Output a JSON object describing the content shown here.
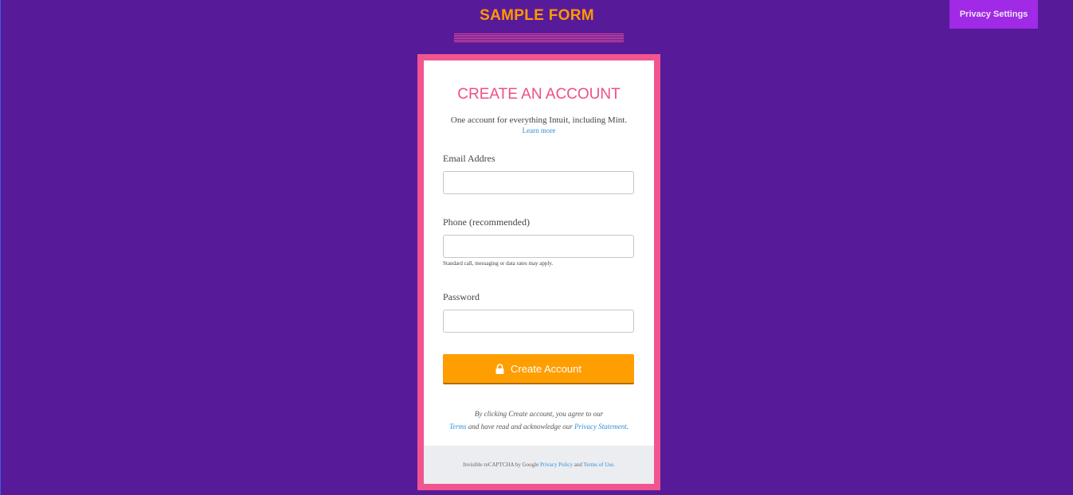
{
  "header": {
    "title": "SAMPLE FORM",
    "privacy_settings_label": "Privacy Settings"
  },
  "card": {
    "heading": "CREATE AN ACCOUNT",
    "subtitle": "One account for everything Intuit, including Mint.",
    "learn_more": "Learn more",
    "fields": {
      "email": {
        "label": "Email Addres",
        "value": "",
        "placeholder": ""
      },
      "phone": {
        "label": "Phone (recommended)",
        "value": "",
        "placeholder": "",
        "hint": "Standard call, messaging or data rates may apply."
      },
      "password": {
        "label": "Password",
        "value": "",
        "placeholder": ""
      }
    },
    "submit_label": "Create Account",
    "submit_icon": "lock-icon",
    "agreement": {
      "line1": "By clicking Create account, you agree to our",
      "terms": "Terms",
      "middle": " and have read and acknowledge our ",
      "privacy_statement": "Privacy Statement",
      "end": "."
    },
    "footer": {
      "prefix": "Invisible reCAPTCHA by Google ",
      "privacy_policy": "Privacy Policy",
      "and": " and ",
      "terms_of_use": "Terms of Use",
      "end": "."
    }
  },
  "colors": {
    "background": "#571b99",
    "title": "#ff9900",
    "frame": "#f1558f",
    "heading": "#ee4f85",
    "privacy_button": "#a12ae6",
    "submit_button": "#ff9e00",
    "link": "#2f8fd8"
  }
}
